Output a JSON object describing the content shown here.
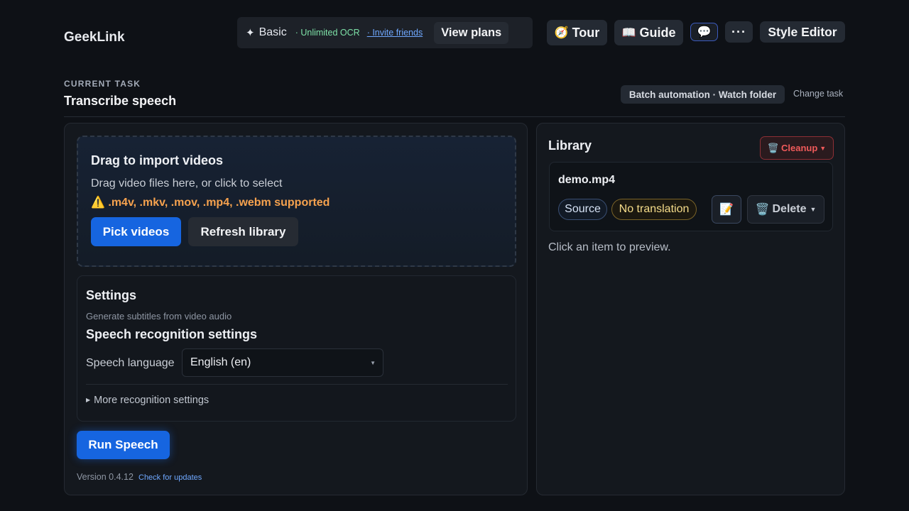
{
  "header": {
    "brand": "GeekLink",
    "plan": {
      "star": "✦",
      "name": "Basic",
      "ocr": "· Unlimited OCR",
      "invite": "· Invite friends",
      "view_plans": "View plans"
    },
    "tour": {
      "icon": "🧭",
      "label": "Tour"
    },
    "guide": {
      "icon": "📖",
      "label": "Guide"
    },
    "chat_icon": "💬",
    "more_icon": "···",
    "style_editor": "Style Editor"
  },
  "task": {
    "label": "CURRENT TASK",
    "title": "Transcribe speech",
    "batch": "Batch automation · Watch folder",
    "change": "Change task"
  },
  "import": {
    "title": "Drag to import videos",
    "subtitle": "Drag video files here, or click to select",
    "warning": "⚠️ .m4v, .mkv, .mov, .mp4, .webm supported",
    "pick": "Pick videos",
    "refresh": "Refresh library"
  },
  "settings": {
    "title": "Settings",
    "description": "Generate subtitles from video audio",
    "subtitle": "Speech recognition settings",
    "language_label": "Speech language",
    "language_value": "English (en)",
    "more": "More recognition settings"
  },
  "run_label": "Run Speech",
  "version": "Version 0.4.12",
  "check_updates": "Check for updates",
  "library": {
    "title": "Library",
    "cleanup": {
      "icon": "🗑️",
      "label": "Cleanup"
    },
    "items": [
      {
        "name": "demo.mp4",
        "source_badge": "Source",
        "translation_badge": "No translation",
        "edit_icon": "📝",
        "delete": {
          "icon": "🗑️",
          "label": "Delete"
        }
      }
    ],
    "preview_hint": "Click an item to preview."
  },
  "colors": {
    "background": "#0e1116",
    "accent": "#1665e0",
    "warning": "#f6a24e",
    "danger": "#f05a5a",
    "success": "#7ee2a8",
    "link": "#6fa8ff"
  }
}
